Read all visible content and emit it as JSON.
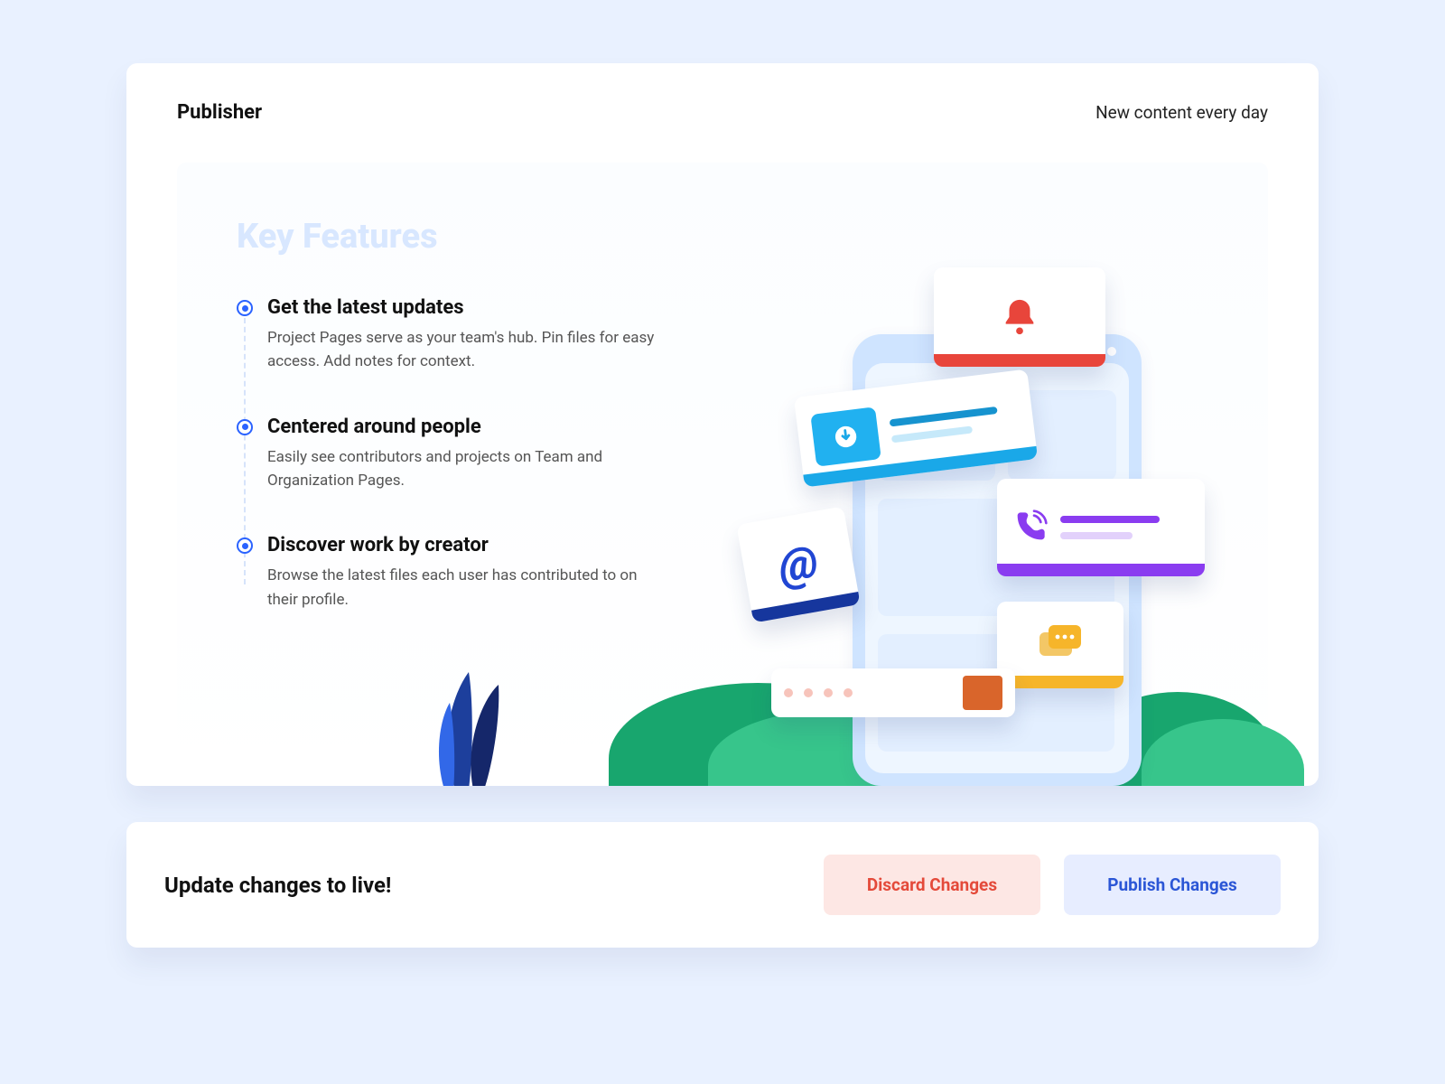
{
  "header": {
    "title": "Publisher",
    "tagline": "New content every day"
  },
  "features": {
    "heading": "Key Features",
    "items": [
      {
        "title": "Get the latest updates",
        "desc": "Project Pages serve as your team's hub. Pin files for easy access. Add notes for context."
      },
      {
        "title": "Centered around people",
        "desc": "Easily see contributors and projects on Team and Organization Pages."
      },
      {
        "title": "Discover work by creator",
        "desc": "Browse the latest files each user has contributed to on their profile."
      }
    ]
  },
  "actions": {
    "prompt": "Update changes to live!",
    "discard_label": "Discard Changes",
    "publish_label": "Publish Changes"
  },
  "illustration": {
    "widgets": [
      "bell-icon",
      "download-card",
      "at-symbol",
      "phone-call-card",
      "chat-bubble",
      "search-bar"
    ]
  }
}
